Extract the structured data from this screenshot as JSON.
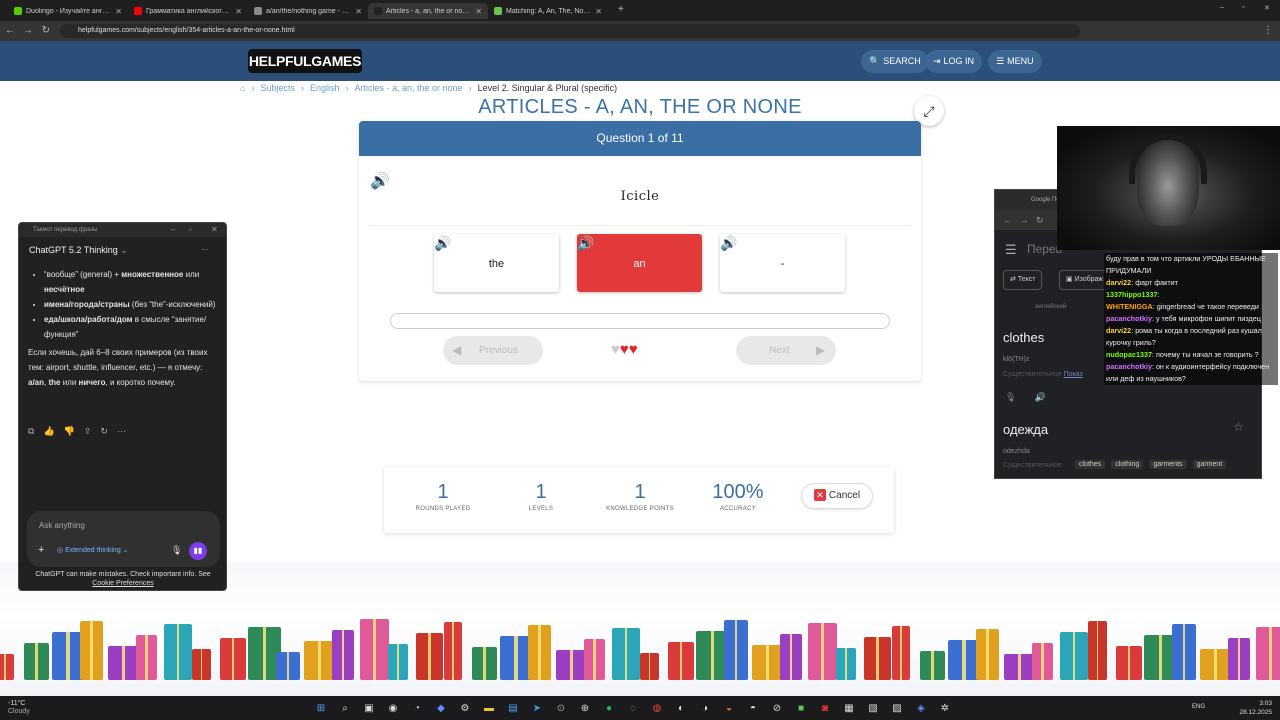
{
  "browser": {
    "tabs": [
      {
        "title": "Duolingo - Изучайте английский",
        "color": "#58cc02"
      },
      {
        "title": "Грамматика английского языка",
        "color": "#ff0000"
      },
      {
        "title": "a/an/the/nothing game - Google",
        "color": "#888888"
      },
      {
        "title": "Articles - a, an, the or none! Pl",
        "color": "#222222",
        "active": true
      },
      {
        "title": "Matching: A, An, The, No Articl",
        "color": "#6cc24a"
      }
    ],
    "url": "helpfulgames.com/subjects/english/354-articles-a-an-the-or-none.html"
  },
  "site": {
    "logo": "HELPFULGAMES",
    "search": "SEARCH",
    "login": "LOG IN",
    "menu": "MENU"
  },
  "breadcrumb": [
    "Subjects",
    "English",
    "Articles - a, an, the or none",
    "Level 2. Singular & Plural (specific)"
  ],
  "page_title": "ARTICLES - A, AN, THE OR NONE",
  "quiz": {
    "question_counter": "Question 1 of 11",
    "prompt": "Icicle",
    "answers": [
      {
        "label": "the",
        "selected": false
      },
      {
        "label": "an",
        "selected": true
      },
      {
        "label": "-",
        "selected": false
      }
    ],
    "progress": 0,
    "previous": "Previous",
    "next": "Next",
    "hearts": {
      "total": 3,
      "remaining": 2
    }
  },
  "stats": {
    "rounds": {
      "value": "1",
      "label": "ROUNDS PLAYED"
    },
    "levels": {
      "value": "1",
      "label": "LEVELS"
    },
    "knowledge": {
      "value": "1",
      "label": "KNOWLEDGE POINTS"
    },
    "accuracy": {
      "value": "100%",
      "label": "ACCURACY"
    },
    "cancel": "Cancel"
  },
  "chatgpt": {
    "window_title": "Такмот перевод фразы",
    "model": "ChatGPT 5.2 Thinking",
    "bullets": [
      [
        "“вообще” (general) + ",
        "множественное",
        " или ",
        "несчётное"
      ],
      [
        "имена/города/страны",
        " (без “the”-исключений)",
        "",
        ""
      ],
      [
        "еда/школа/работа/дом",
        " в смысле “занятие/функция”",
        "",
        ""
      ]
    ],
    "paragraph_a": "Если хочешь, дай 6–8 своих примеров (из твоих тем: airport, shuttle, influencer, etc.) — я отмечу: ",
    "paragraph_b": "a/an",
    "paragraph_c": ", ",
    "paragraph_d": "the",
    "paragraph_e": " или ",
    "paragraph_f": "ничего",
    "paragraph_g": ", и коротко почему.",
    "input_placeholder": "Ask anything",
    "extended": "Extended thinking",
    "footer": "ChatGPT can make mistakes. Check important info. See",
    "footer_link": "Cookie Preferences"
  },
  "translator": {
    "tab_title": "Google Пе",
    "header": "Перев",
    "text_btn": "Текст",
    "images_btn": "Изображ",
    "source_lang": "английский",
    "word": "clothes",
    "transcription": "klō(TH)z",
    "pos": "Существительное",
    "show": "Показ",
    "result": "одежда",
    "result_translit": "odezhda",
    "pos2": "Существительное",
    "chips": [
      "clothes",
      "clothing",
      "garments",
      "garment"
    ]
  },
  "chat_overlay": [
    {
      "user": "",
      "text": "буду прав в том что артикли УРОДЫ ЕБАННЫЕ ПРИДУМАЛИ",
      "color": "#ffffff"
    },
    {
      "user": "darvi22",
      "text": "фарт фактит",
      "color": "#f0d040"
    },
    {
      "user": "1337hippo1337",
      "text": "",
      "color": "#7cfc00"
    },
    {
      "user": "WHITENIGGA",
      "text": "gingerbread че такое переведи",
      "color": "#ffa500"
    },
    {
      "user": "pacanchotkiy",
      "text": "у тебя микрофон шипит пиздец",
      "color": "#d070ff"
    },
    {
      "user": "darvi22",
      "text": "рома ты когда в последний раз кушал курочку гриль?",
      "color": "#f0d040"
    },
    {
      "user": "nudopac1337",
      "text": "почему ты начал зе говорить ?",
      "color": "#7cfc00"
    },
    {
      "user": "pacanchotkiy",
      "text": "он к аудиоинтерфейсу подключен или деф из наушников?",
      "color": "#d070ff"
    }
  ],
  "taskbar": {
    "weather_temp": "-11°C",
    "weather_cond": "Cloudy",
    "lang": "ENG",
    "time": "3:03",
    "date": "28.12.2025"
  }
}
